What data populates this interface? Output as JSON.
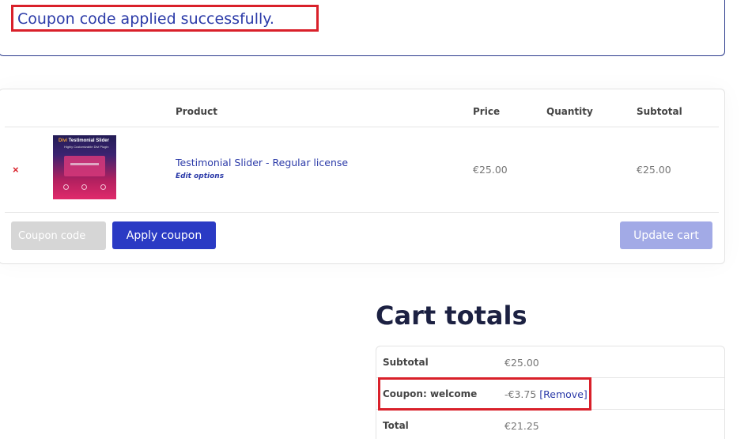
{
  "notice": {
    "message": "Coupon code applied successfully."
  },
  "cart": {
    "headers": {
      "product": "Product",
      "price": "Price",
      "quantity": "Quantity",
      "subtotal": "Subtotal"
    },
    "items": [
      {
        "remove_icon": "×",
        "thumbnail": {
          "title_accent": "Divi",
          "title_rest": " Testimonial Slider",
          "subtitle": "Highly Customizable Divi Plugin"
        },
        "name": "Testimonial Slider - Regular license",
        "edit_options": "Edit options",
        "price": "€25.00",
        "subtotal": "€25.00"
      }
    ],
    "coupon_placeholder": "Coupon code",
    "apply_coupon_label": "Apply coupon",
    "update_cart_label": "Update cart"
  },
  "totals": {
    "title": "Cart totals",
    "subtotal_label": "Subtotal",
    "subtotal_value": "€25.00",
    "coupon_label": "Coupon: welcome",
    "coupon_value": "-€3.75",
    "coupon_remove": "[Remove]",
    "total_label": "Total",
    "total_value": "€21.25"
  },
  "colors": {
    "accent": "#2a3ac4",
    "highlight": "#d9202a",
    "link": "#2b3aa8"
  }
}
